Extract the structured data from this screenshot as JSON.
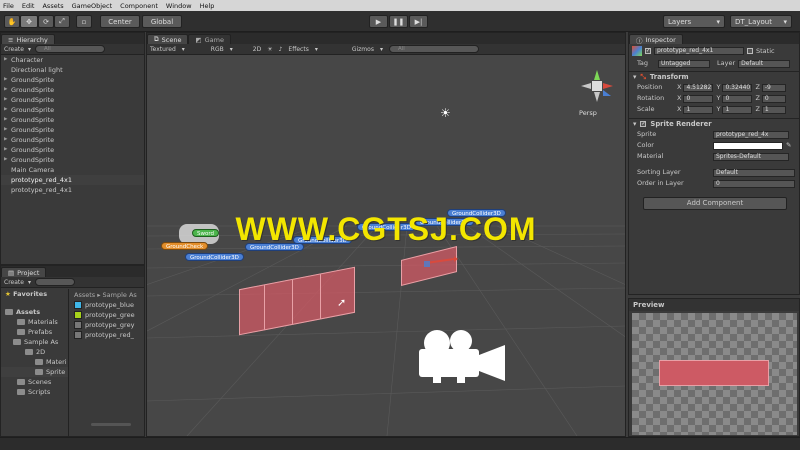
{
  "menu": [
    "File",
    "Edit",
    "Assets",
    "GameObject",
    "Component",
    "Window",
    "Help"
  ],
  "toolbar": {
    "center": "Center",
    "global": "Global",
    "layers": "Layers",
    "layout": "DT_Layout"
  },
  "hierarchy": {
    "tab": "Hierarchy",
    "create": "Create",
    "search": "All",
    "items": [
      {
        "label": "Character",
        "arrow": true
      },
      {
        "label": "Directional light",
        "arrow": false
      },
      {
        "label": "GroundSprite",
        "arrow": true
      },
      {
        "label": "GroundSprite",
        "arrow": true
      },
      {
        "label": "GroundSprite",
        "arrow": true
      },
      {
        "label": "GroundSprite",
        "arrow": true
      },
      {
        "label": "GroundSprite",
        "arrow": true
      },
      {
        "label": "GroundSprite",
        "arrow": true
      },
      {
        "label": "GroundSprite",
        "arrow": true
      },
      {
        "label": "GroundSprite",
        "arrow": true
      },
      {
        "label": "GroundSprite",
        "arrow": true
      },
      {
        "label": "Main Camera",
        "arrow": false
      },
      {
        "label": "prototype_red_4x1",
        "arrow": false,
        "selected": true
      },
      {
        "label": "prototype_red_4x1",
        "arrow": false
      }
    ]
  },
  "project": {
    "tab": "Project",
    "create": "Create",
    "favorites": "Favorites",
    "assets": "Assets",
    "tree": [
      "Materials",
      "Prefabs",
      "Sample As",
      "2D",
      "Materi",
      "Sprite",
      "Scenes",
      "Scripts"
    ],
    "breadcrumb": "Assets ▸ Sample As",
    "files": [
      {
        "label": "prototype_blue",
        "color": "#3fb6e8"
      },
      {
        "label": "prototype_gree",
        "color": "#a6d21b"
      },
      {
        "label": "prototype_grey",
        "color": ""
      },
      {
        "label": "prototype_red_",
        "color": ""
      }
    ]
  },
  "scene": {
    "tab_scene": "Scene",
    "tab_game": "Game",
    "textured": "Textured",
    "rgb": "RGB",
    "mode2d": "2D",
    "effects": "Effects",
    "gizmos": "Gizmos",
    "search": "All",
    "persp": "Persp",
    "watermark": "WWW.CGTSJ.COM",
    "labels": {
      "groundcheck": "GroundCheck",
      "sword": "Sword",
      "collider": "GroundCollider3D",
      "collider_top": "GroundCollider3D"
    }
  },
  "inspector": {
    "tab": "Inspector",
    "object_name": "prototype_red_4x1",
    "static": "Static",
    "tag_label": "Tag",
    "tag_value": "Untagged",
    "layer_label": "Layer",
    "layer_value": "Default",
    "transform": {
      "title": "Transform",
      "position": {
        "label": "Position",
        "x": "4.51282",
        "y": "0.32440",
        "z": "-9"
      },
      "rotation": {
        "label": "Rotation",
        "x": "0",
        "y": "0",
        "z": "0"
      },
      "scale": {
        "label": "Scale",
        "x": "1",
        "y": "1",
        "z": "1"
      }
    },
    "sprite_renderer": {
      "title": "Sprite Renderer",
      "sprite_label": "Sprite",
      "sprite_value": "prototype_red_4x",
      "color_label": "Color",
      "material_label": "Material",
      "material_value": "Sprites-Default",
      "sorting_label": "Sorting Layer",
      "sorting_value": "Default",
      "order_label": "Order in Layer",
      "order_value": "0"
    },
    "add_component": "Add Component",
    "preview": "Preview"
  },
  "colors": {
    "accent_blue": "#4a7fd3",
    "sprite_red": "#cd5a64",
    "watermark": "#f3e600",
    "selection": "#3f3f3f"
  }
}
